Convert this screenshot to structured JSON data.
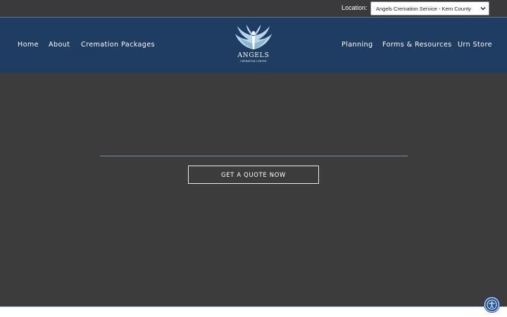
{
  "topbar": {
    "location_label": "Location:",
    "location_selected": "Angels Cremation Service - Kern County"
  },
  "nav": {
    "left": [
      "Home",
      "About",
      "Cremation Packages"
    ],
    "right": [
      "Planning",
      "Forms & Resources",
      "Urn Store"
    ]
  },
  "logo": {
    "title": "ANGELS",
    "subtitle": "CREMATION CENTER"
  },
  "hero": {
    "cta_label": "GET A QUOTE NOW"
  },
  "icons": {
    "location_select": "chevron-down-icon",
    "logo": "angel-wings-icon",
    "accessibility": "accessibility-icon"
  },
  "colors": {
    "topbar": "#3a3a3c",
    "navbar": "#1f3c63",
    "hero": "#3c3c3c",
    "accent_line": "#6d93a8",
    "accessibility_button": "#1f4fa6"
  }
}
